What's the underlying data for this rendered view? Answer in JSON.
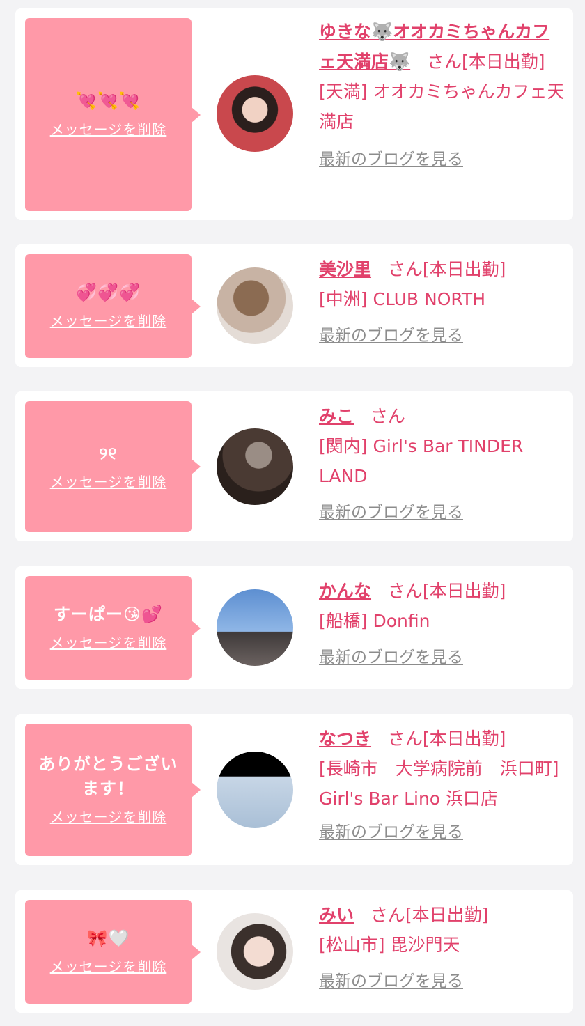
{
  "colors": {
    "background": "#f3f3f5",
    "card": "#ffffff",
    "bubble": "#ff99a8",
    "accent": "#e1416b",
    "link_gray": "#8c8c8c"
  },
  "delete_label": "メッセージを削除",
  "blog_label": "最新のブログを見る",
  "cards": [
    {
      "message": "💘💘💘",
      "name": "ゆきな🐺オオカミちゃんカフェ天満店🐺",
      "san": "さん",
      "status": "[本日出勤]",
      "shop": "[天満] オオカミちゃんカフェ天満店",
      "avatar_icon": "avatar-photo"
    },
    {
      "message": "💞💞💞",
      "name": "美沙里",
      "san": "さん",
      "status": "[本日出勤]",
      "shop": "[中洲] CLUB NORTH",
      "avatar_icon": "avatar-photo"
    },
    {
      "message": "୨୧",
      "name": "みこ",
      "san": "さん",
      "status": "",
      "shop": "[関内] Girl's Bar TINDER LAND",
      "avatar_icon": "avatar-photo"
    },
    {
      "message": "すーぱー😘💕",
      "name": "かんな",
      "san": "さん",
      "status": "[本日出勤]",
      "shop": "[船橋] Donfin",
      "avatar_icon": "avatar-photo"
    },
    {
      "message": "ありがとうございます！",
      "name": "なつき",
      "san": "さん",
      "status": "[本日出勤]",
      "shop": "[長崎市　大学病院前　浜口町] Girl's Bar Lino 浜口店",
      "avatar_icon": "avatar-photo"
    },
    {
      "message": "🎀🤍",
      "name": "みい",
      "san": "さん",
      "status": "[本日出勤]",
      "shop": "[松山市] 毘沙門天",
      "avatar_icon": "avatar-photo"
    }
  ]
}
